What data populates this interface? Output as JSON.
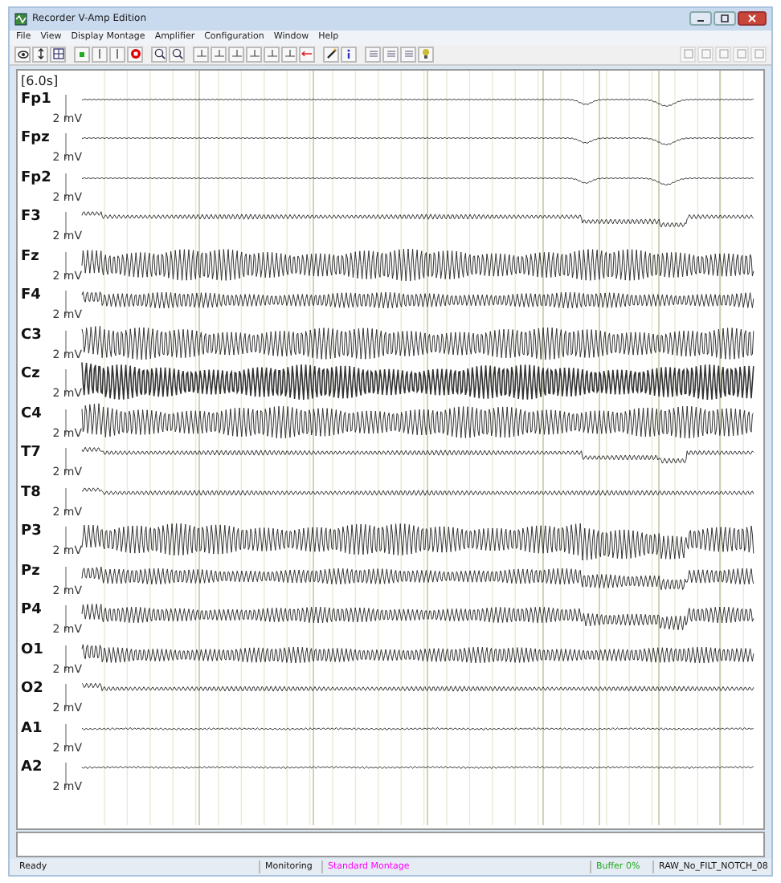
{
  "window": {
    "title": "Recorder V-Amp Edition"
  },
  "menu": [
    "File",
    "View",
    "Display Montage",
    "Amplifier",
    "Configuration",
    "Window",
    "Help"
  ],
  "time_scale": "[6.0s]",
  "channels": [
    {
      "name": "Fp1",
      "scale": "2 mV",
      "kind": "flat",
      "artifact": true
    },
    {
      "name": "Fpz",
      "scale": "2 mV",
      "kind": "flat",
      "artifact": true
    },
    {
      "name": "Fp2",
      "scale": "2 mV",
      "kind": "flat",
      "artifact": true
    },
    {
      "name": "F3",
      "scale": "2 mV",
      "kind": "thin",
      "artifact": true
    },
    {
      "name": "Fz",
      "scale": "2 mV",
      "kind": "wide",
      "artifact": false
    },
    {
      "name": "F4",
      "scale": "2 mV",
      "kind": "medium",
      "artifact": false
    },
    {
      "name": "C3",
      "scale": "2 mV",
      "kind": "wide",
      "artifact": false
    },
    {
      "name": "Cz",
      "scale": "2 mV",
      "kind": "heavy",
      "artifact": false
    },
    {
      "name": "C4",
      "scale": "2 mV",
      "kind": "wide",
      "artifact": false
    },
    {
      "name": "T7",
      "scale": "2 mV",
      "kind": "thin",
      "artifact": true
    },
    {
      "name": "T8",
      "scale": "2 mV",
      "kind": "thin",
      "artifact": false
    },
    {
      "name": "P3",
      "scale": "2 mV",
      "kind": "wide",
      "artifact": true
    },
    {
      "name": "Pz",
      "scale": "2 mV",
      "kind": "medium",
      "artifact": true
    },
    {
      "name": "P4",
      "scale": "2 mV",
      "kind": "medium",
      "artifact": true
    },
    {
      "name": "O1",
      "scale": "2 mV",
      "kind": "medium",
      "artifact": false
    },
    {
      "name": "O2",
      "scale": "2 mV",
      "kind": "thin",
      "artifact": false
    },
    {
      "name": "A1",
      "scale": "2 mV",
      "kind": "noise",
      "artifact": false
    },
    {
      "name": "A2",
      "scale": "2 mV",
      "kind": "noise",
      "artifact": false
    }
  ],
  "status_bar": [
    {
      "text": "Ready"
    },
    {
      "text": "Monitoring"
    },
    {
      "text": "Standard Montage",
      "color": "#ff00ff"
    },
    {
      "text": "Buffer 0%",
      "color": "#22aa22"
    },
    {
      "text": "RAW_No_FILT_NOTCH_08"
    }
  ]
}
